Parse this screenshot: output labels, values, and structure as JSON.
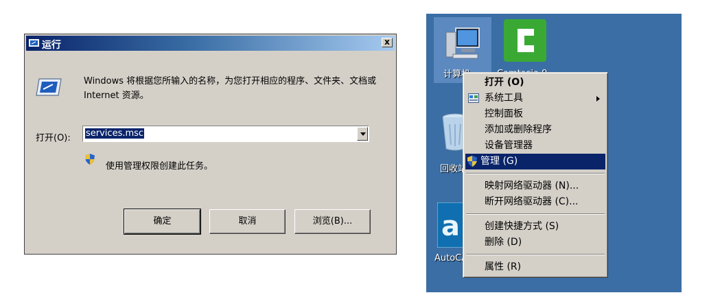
{
  "run_dialog": {
    "title": "运行",
    "close_glyph": "x",
    "description": "Windows 将根据您所输入的名称，为您打开相应的程序、文件夹、文档或 Internet 资源。",
    "open_label": "打开(O):",
    "command_value": "services.msc",
    "admin_note": "使用管理权限创建此任务。",
    "ok_label": "确定",
    "cancel_label": "取消",
    "browse_label": "浏览(B)..."
  },
  "desktop": {
    "icons": [
      {
        "label": "计算机",
        "icon": "computer-icon"
      },
      {
        "label": "Camtasia 9",
        "icon": "camtasia-icon"
      },
      {
        "label": "回收站",
        "icon": "recycle-bin-icon"
      },
      {
        "label": "AutoCAD 2007",
        "icon": "autocad-icon"
      }
    ]
  },
  "context_menu": {
    "items": [
      {
        "label": "打开 (O)",
        "bold": true
      },
      {
        "label": "系统工具",
        "submenu": true,
        "icon": "system-tools-icon"
      },
      {
        "label": "控制面板"
      },
      {
        "label": "添加或删除程序"
      },
      {
        "label": "设备管理器"
      },
      {
        "label": "管理 (G)",
        "selected": true,
        "icon": "shield-icon"
      },
      {
        "label": "映射网络驱动器 (N)..."
      },
      {
        "label": "断开网络驱动器 (C)..."
      },
      {
        "label": "创建快捷方式 (S)"
      },
      {
        "label": "删除 (D)"
      },
      {
        "label": "属性 (R)"
      }
    ]
  },
  "colors": {
    "desktop_bg": "#3a6ea5",
    "selection": "#0a246a",
    "dialog_face": "#d4d0c8"
  }
}
